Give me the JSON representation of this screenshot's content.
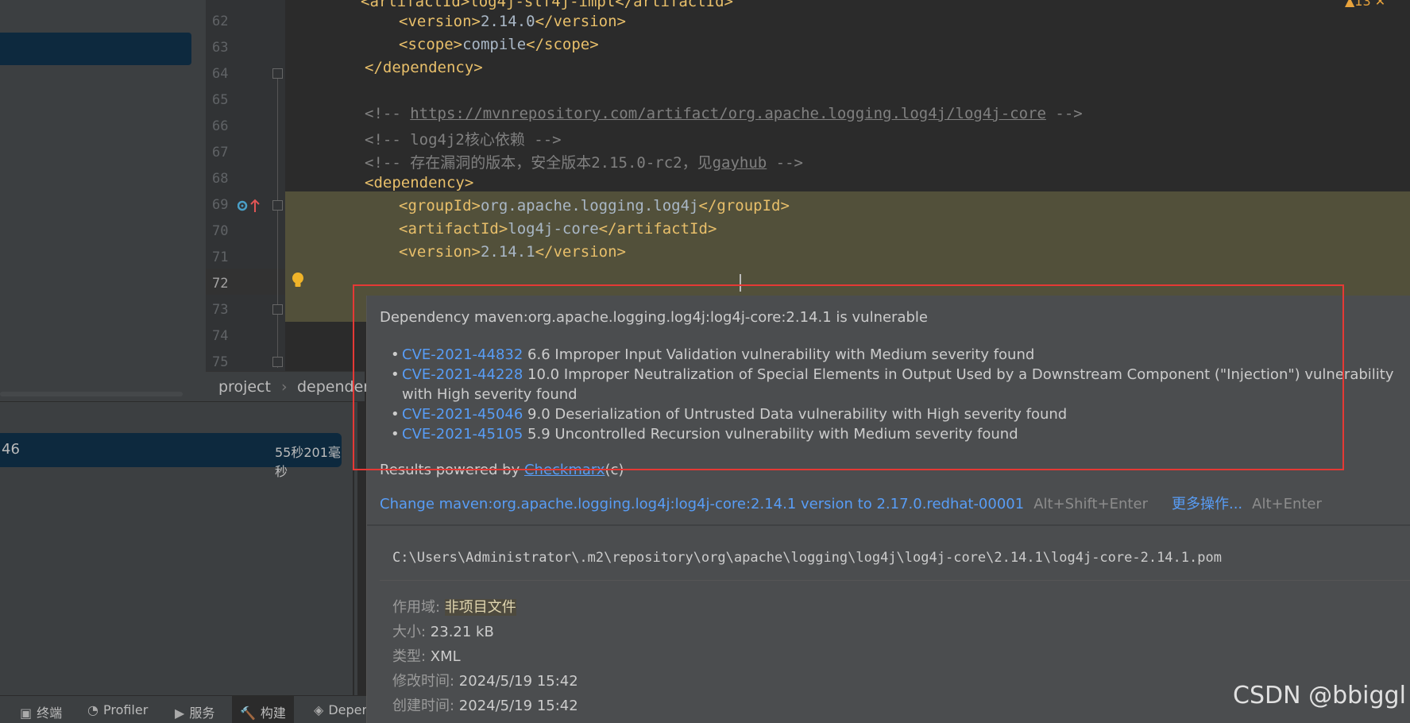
{
  "editor": {
    "line_numbers": [
      "62",
      "63",
      "64",
      "65",
      "66",
      "67",
      "68",
      "69",
      "70",
      "71",
      "72",
      "73",
      "74",
      "75"
    ],
    "current_line": "72",
    "lines": {
      "l61_partial": "<artifactId>log4j-slf4j-impl</artifactId>",
      "l62_open": "<version>",
      "l62_val": "2.14.0",
      "l62_close": "</version>",
      "l63_open": "<scope>",
      "l63_val": "compile",
      "l63_close": "</scope>",
      "l64": "</dependency>",
      "l66_open": "<!-- ",
      "l66_url": "https://mvnrepository.com/artifact/org.apache.logging.log4j/log4j-core",
      "l66_close": " -->",
      "l67": "<!-- log4j2核心依赖 -->",
      "l68_open": "<!-- 存在漏洞的版本，安全版本2.15.0-rc2，见",
      "l68_word": "gayhub",
      "l68_close": " -->",
      "l69": "<dependency>",
      "l70_open": "<groupId>",
      "l70_val": "org.apache.logging.log4j",
      "l70_close": "</groupId>",
      "l71_open": "<artifactId>",
      "l71_val": "log4j-core",
      "l71_close": "</artifactId>",
      "l72_open": "<version>",
      "l72_val": "2.14.1",
      "l72_close": "</version>"
    }
  },
  "breadcrumb": {
    "items": [
      "project",
      "dependen"
    ],
    "separator": "›"
  },
  "build": {
    "row_left": "46",
    "row_time": "55秒201毫秒"
  },
  "tool_tabs": [
    {
      "icon": "terminal-icon",
      "glyph": "▣",
      "label": "终端"
    },
    {
      "icon": "profiler-icon",
      "glyph": "◔",
      "label": "Profiler"
    },
    {
      "icon": "services-icon",
      "glyph": "▶",
      "label": "服务"
    },
    {
      "icon": "build-icon",
      "glyph": "🔨",
      "label": "构建"
    },
    {
      "icon": "dependencies-icon",
      "glyph": "◈",
      "label": "Deper"
    }
  ],
  "popup": {
    "title": "Dependency maven:org.apache.logging.log4j:log4j-core:2.14.1 is vulnerable",
    "cves": [
      {
        "id": "CVE-2021-44832",
        "desc": " 6.6 Improper Input Validation vulnerability with Medium severity found"
      },
      {
        "id": "CVE-2021-44228",
        "desc": " 10.0 Improper Neutralization of Special Elements in Output Used by a Downstream Component (\"Injection\") vulnerability with High severity found"
      },
      {
        "id": "CVE-2021-45046",
        "desc": " 9.0 Deserialization of Untrusted Data vulnerability with High severity found"
      },
      {
        "id": "CVE-2021-45105",
        "desc": " 5.9 Uncontrolled Recursion vulnerability with Medium severity found"
      }
    ],
    "powered_prefix": "Results powered by ",
    "powered_link": "Checkmarx",
    "powered_suffix": "(c)",
    "fix_action": "Change maven:org.apache.logging.log4j:log4j-core:2.14.1 version to 2.17.0.redhat-00001",
    "fix_shortcut": "Alt+Shift+Enter",
    "more_actions": "更多操作...",
    "more_shortcut": "Alt+Enter",
    "file_path": "C:\\Users\\Administrator\\.m2\\repository\\org\\apache\\logging\\log4j\\log4j-core\\2.14.1\\log4j-core-2.14.1.pom",
    "meta": [
      {
        "key": "作用域: ",
        "value": "非项目文件"
      },
      {
        "key": "大小: ",
        "value": "23.21 kB"
      },
      {
        "key": "类型: ",
        "value": "XML"
      },
      {
        "key": "修改时间: ",
        "value": "2024/5/19 15:42"
      },
      {
        "key": "创建时间: ",
        "value": "2024/5/19 15:42"
      }
    ]
  },
  "watermark": "CSDN @bbiggl",
  "top_badge": "▲13 ✕"
}
